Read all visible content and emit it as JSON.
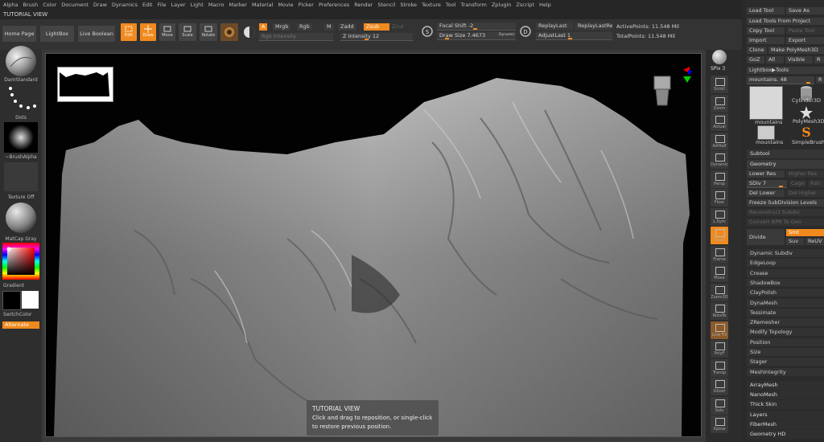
{
  "menu": [
    "Alpha",
    "Brush",
    "Color",
    "Document",
    "Draw",
    "Dynamics",
    "Edit",
    "File",
    "Layer",
    "Light",
    "Macro",
    "Marker",
    "Material",
    "Movie",
    "Picker",
    "Preferences",
    "Render",
    "Stencil",
    "Stroke",
    "Texture",
    "Tool",
    "Transform",
    "Zplugin",
    "Zscript",
    "Help"
  ],
  "window_title": "TUTORIAL VIEW",
  "shelf": {
    "home_page": "Home Page",
    "lightbox": "LightBox",
    "live_boolean": "Live Boolean",
    "edit": "Edit",
    "draw": "Draw",
    "move": "Move",
    "scale": "Scale",
    "rotate": "Rotate",
    "a_label": "A",
    "mrgb": "Mrgb",
    "rgb": "Rgb",
    "m": "M",
    "zadd": "Zadd",
    "zsub": "Zsub",
    "zcut": "Zcut",
    "rgb_intensity": "Rgb Intensity",
    "z_intensity": "Z Intensity 12",
    "focal_shift": "Focal Shift -2",
    "draw_size": "Draw Size 7.4673",
    "dynamic": "Dynamic",
    "replay_last": "ReplayLast",
    "replay_last_rel": "ReplayLastRel",
    "adjust_last": "AdjustLast 1",
    "active_points": "ActivePoints: 11.548 Mil",
    "total_points": "TotalPoints: 11.548 Mil",
    "s_label": "S",
    "d_label": "D"
  },
  "left": {
    "brush": "DamStandard",
    "stroke": "Dots",
    "alpha": "~BrushAlpha",
    "texture": "Texture Off",
    "material": "MatCap Gray",
    "gradient": "Gradient",
    "switch_color": "SwitchColor",
    "alternate": "Alternate"
  },
  "right_shelf": [
    "Scroll",
    "Zoom",
    "Actual",
    "AAHalf",
    "Dynamic",
    "Persp",
    "Floor",
    "L.Sym",
    "Qxyz",
    "Frame",
    "Move",
    "Zoom3D",
    "RotaTe",
    "Line Fill",
    "PolyF",
    "Transp",
    "Ghost",
    "Solo",
    "Xpose",
    "SPix 3"
  ],
  "panel": {
    "load_tool": "Load Tool",
    "save_as": "Save As",
    "load_tools_project": "Load Tools From Project",
    "copy_tool": "Copy Tool",
    "paste_tool": "Paste Tool",
    "import": "Import",
    "export": "Export",
    "clone": "Clone",
    "make_polymesh": "Make PolyMesh3D",
    "goz": "GoZ",
    "all": "All",
    "visible": "Visible",
    "r": "R",
    "lightbox_tools": "Lightbox▶Tools",
    "tool_slider": "mountains. 48",
    "r2": "R",
    "thumbs": [
      "mountains",
      "Cylinder3D",
      "mountains",
      "PolyMesh3D",
      "mountains",
      "SimpleBrush"
    ],
    "subtool": "Subtool",
    "geometry": "Geometry",
    "lower_res": "Lower Res",
    "higher_res": "Higher Res",
    "sdiv": "SDiv 7",
    "cage": "Cage",
    "rstr": "Rstr",
    "del_lower": "Del Lower",
    "del_higher": "Del Higher",
    "freeze_subdivision": "Freeze SubDivision Levels",
    "reconstruct_subdiv": "Reconstruct Subdiv",
    "convert_bpr": "Convert BPR To Geo",
    "divide": "Divide",
    "smt": "Smt",
    "suv": "Suv",
    "reuv": "ReUV",
    "sections": [
      "Dynamic Subdiv",
      "EdgeLoop",
      "Crease",
      "ShadowBox",
      "ClayPolish",
      "DynaMesh",
      "Tessimate",
      "ZRemesher",
      "Modify Topology",
      "Position",
      "Size",
      "Stager",
      "MeshIntegrity"
    ],
    "subsections": [
      "ArrayMesh",
      "NanoMesh",
      "Thick Skin",
      "Layers",
      "FiberMesh",
      "Geometry HD"
    ]
  },
  "tooltip": {
    "title": "TUTORIAL VIEW",
    "line1": "Click and drag to reposition, or single-click",
    "line2": "to restore previous position."
  },
  "colors": {
    "accent": "#f08a1e",
    "background": "#2a2a2a"
  }
}
